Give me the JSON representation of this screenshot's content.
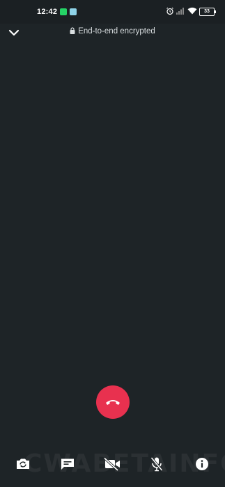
{
  "status_bar": {
    "time": "12:42",
    "battery": "33",
    "notification_icons": [
      "whatsapp-icon",
      "message-icon"
    ],
    "indicator_icons": [
      "alarm-icon",
      "signal-icon",
      "wifi-icon",
      "battery-icon"
    ]
  },
  "header": {
    "encryption_text": "End-to-end encrypted",
    "collapse_icon": "chevron-down-icon",
    "lock_icon": "lock-icon"
  },
  "call": {
    "end_call_icon": "end-call-icon",
    "end_call_color": "#e8314f"
  },
  "controls": [
    {
      "name": "switch-camera",
      "icon": "camera-switch-icon"
    },
    {
      "name": "message",
      "icon": "message-icon"
    },
    {
      "name": "video-off",
      "icon": "video-off-icon"
    },
    {
      "name": "mute",
      "icon": "mic-off-icon"
    },
    {
      "name": "info",
      "icon": "info-icon"
    }
  ],
  "watermark": "CWABETAINFO",
  "colors": {
    "background": "#1e2427",
    "icon": "#ffffff",
    "text": "#d9dee0"
  }
}
